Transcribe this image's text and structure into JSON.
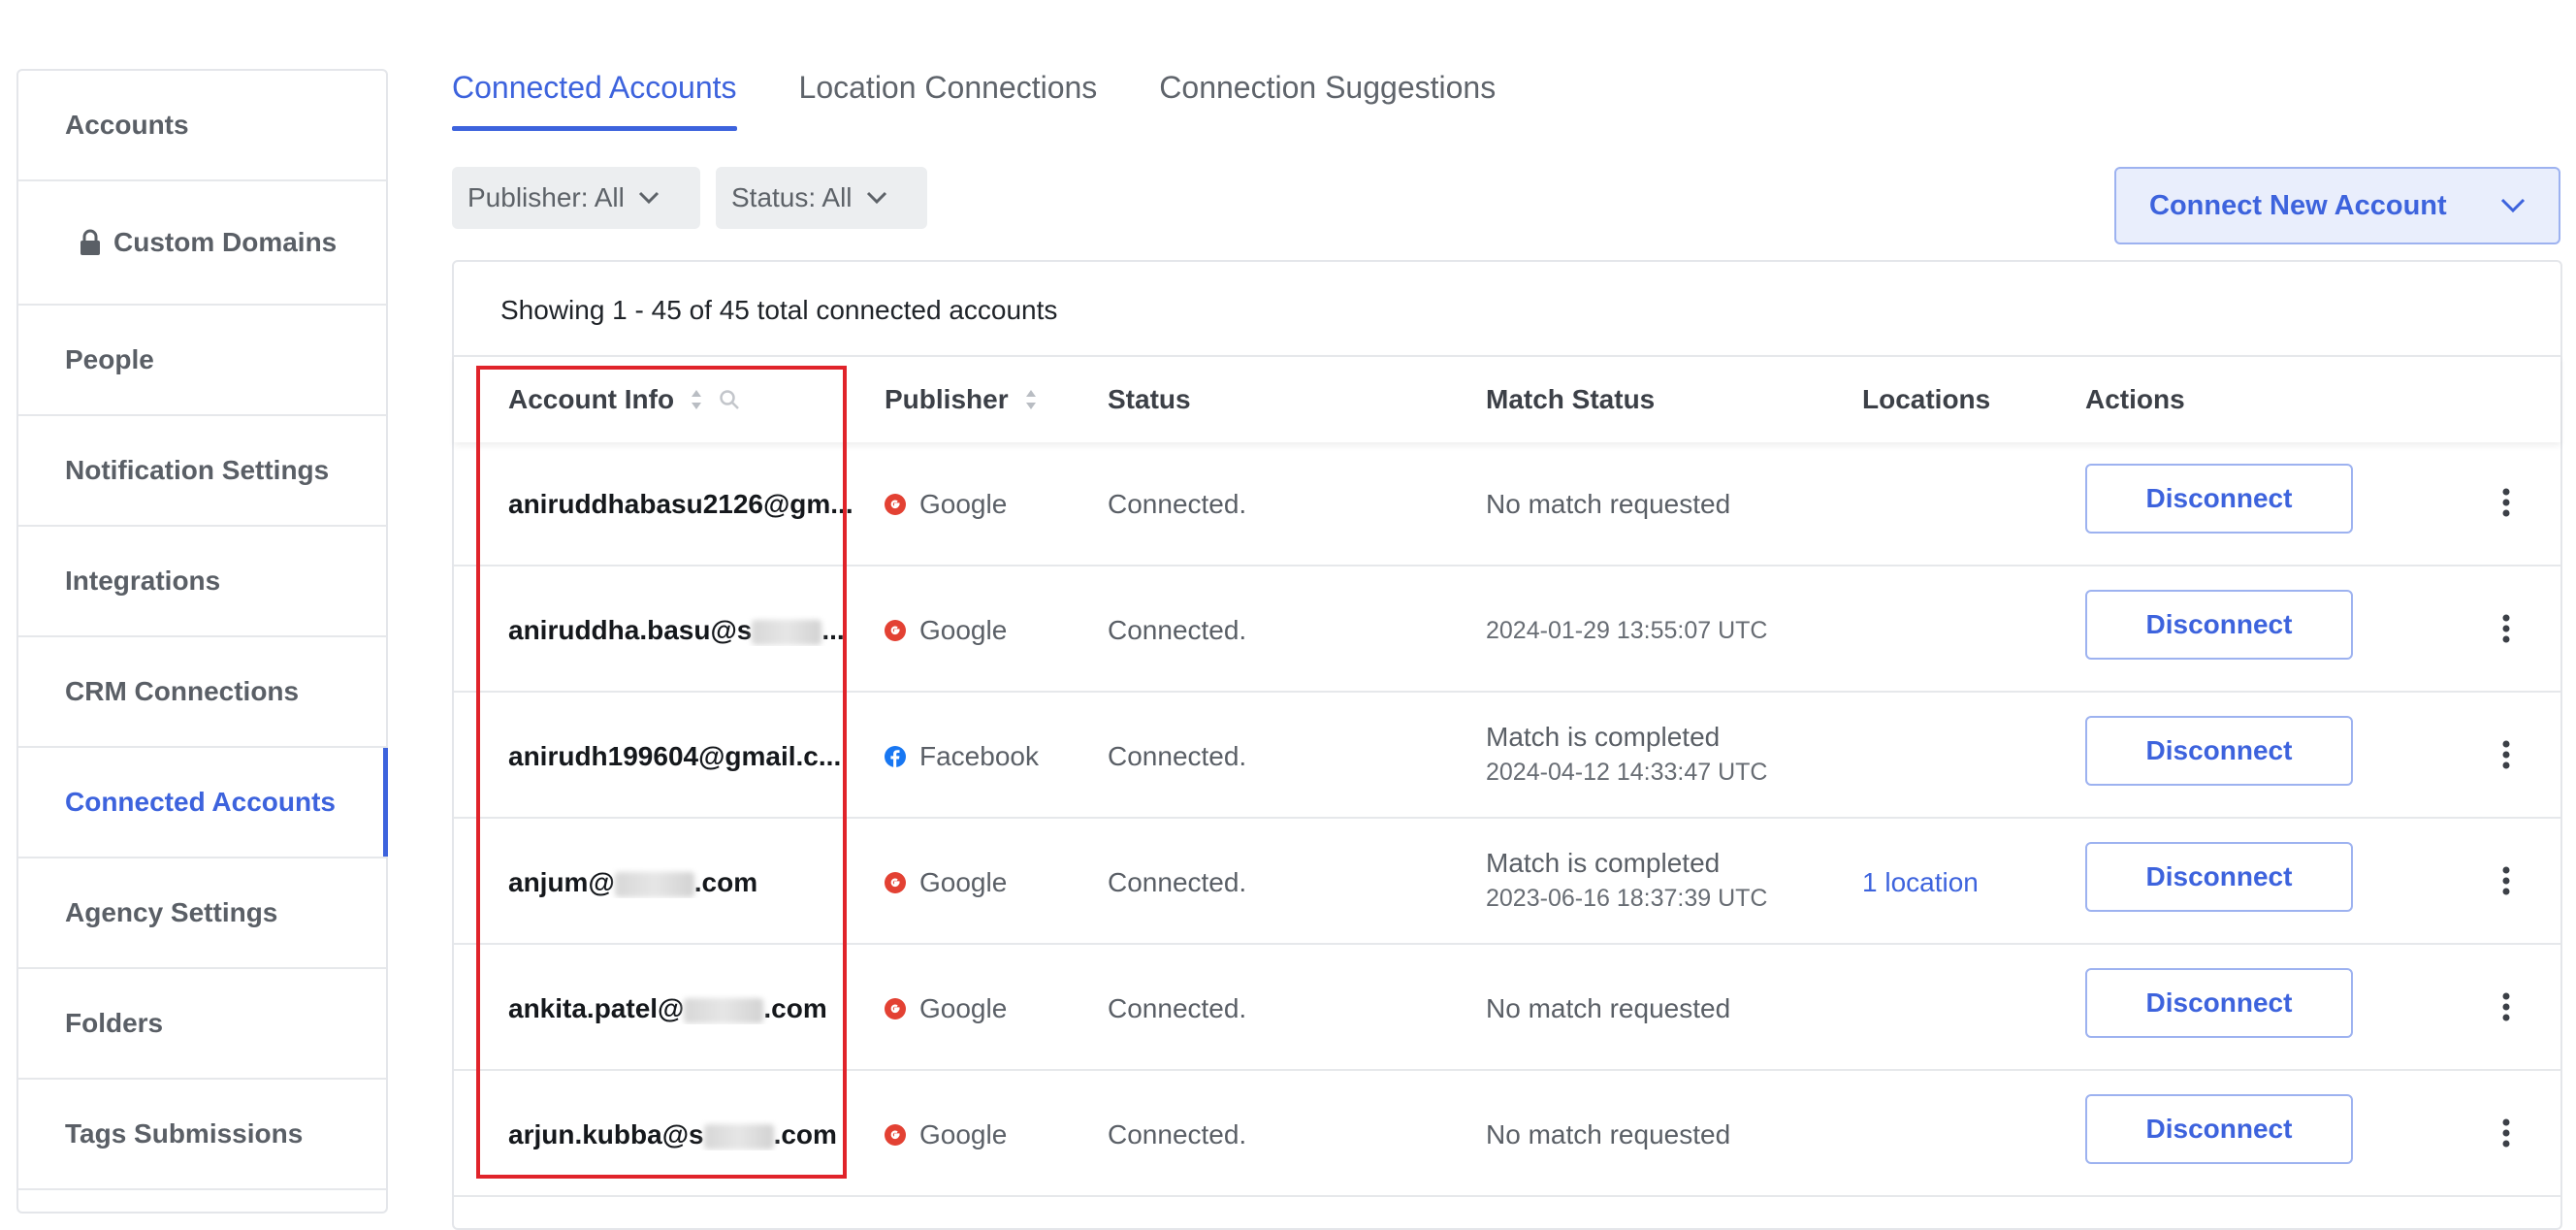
{
  "sidebar": {
    "items": [
      {
        "label": "Accounts"
      },
      {
        "label": "Custom Domains"
      },
      {
        "label": "People"
      },
      {
        "label": "Notification Settings"
      },
      {
        "label": "Integrations"
      },
      {
        "label": "CRM Connections"
      },
      {
        "label": "Connected Accounts"
      },
      {
        "label": "Agency Settings"
      },
      {
        "label": "Folders"
      },
      {
        "label": "Tags Submissions"
      }
    ],
    "active": "Connected Accounts"
  },
  "tabs": [
    {
      "label": "Connected Accounts"
    },
    {
      "label": "Location Connections"
    },
    {
      "label": "Connection Suggestions"
    }
  ],
  "filters": {
    "publisher": "Publisher: All",
    "status": "Status: All"
  },
  "connect_button": "Connect New Account",
  "table": {
    "summary": "Showing 1 - 45 of 45 total connected accounts",
    "columns": [
      "Account Info",
      "Publisher",
      "Status",
      "Match Status",
      "Locations",
      "Actions"
    ],
    "rows": [
      {
        "account_pre": "aniruddhabasu2126@gm...",
        "account_post": "",
        "publisher": "Google",
        "status": "Connected.",
        "match": "No match requested",
        "match_time": "",
        "locations": "",
        "action": "Disconnect"
      },
      {
        "account_pre": "aniruddha.basu@s",
        "account_post": "...",
        "publisher": "Google",
        "status": "Connected.",
        "match": "",
        "match_time": "2024-01-29 13:55:07 UTC",
        "locations": "",
        "action": "Disconnect"
      },
      {
        "account_pre": "anirudh199604@gmail.c...",
        "account_post": "",
        "publisher": "Facebook",
        "status": "Connected.",
        "match": "Match is completed",
        "match_time": "2024-04-12 14:33:47 UTC",
        "locations": "",
        "action": "Disconnect"
      },
      {
        "account_pre": "anjum@",
        "account_post": ".com",
        "publisher": "Google",
        "status": "Connected.",
        "match": "Match is completed",
        "match_time": "2023-06-16 18:37:39 UTC",
        "locations": "1 location",
        "action": "Disconnect"
      },
      {
        "account_pre": "ankita.patel@",
        "account_post": ".com",
        "publisher": "Google",
        "status": "Connected.",
        "match": "No match requested",
        "match_time": "",
        "locations": "",
        "action": "Disconnect"
      },
      {
        "account_pre": "arjun.kubba@s",
        "account_post": ".com",
        "publisher": "Google",
        "status": "Connected.",
        "match": "No match requested",
        "match_time": "",
        "locations": "",
        "action": "Disconnect"
      }
    ]
  },
  "colors": {
    "accent": "#3d63dd",
    "highlight": "#e0232a",
    "google": "#e34133",
    "facebook": "#1877f2"
  }
}
